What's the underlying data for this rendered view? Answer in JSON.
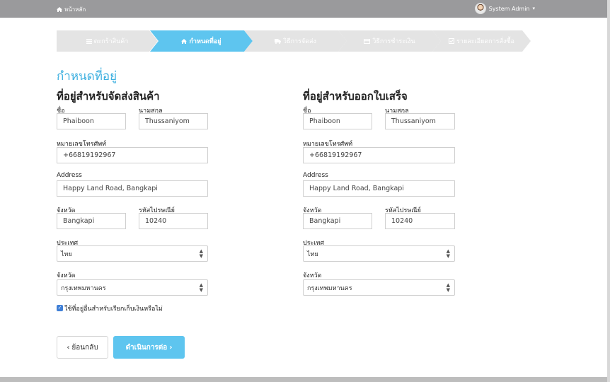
{
  "topbar": {
    "home_label": "หน้าหลัก",
    "user_name": "System Admin",
    "user_caret": "▾"
  },
  "steps": [
    {
      "label": "ตะกร้าสินค้า",
      "icon": "list-icon"
    },
    {
      "label": "กำหนดที่อยู่",
      "icon": "home-icon"
    },
    {
      "label": "วิธีการจัดส่ง",
      "icon": "truck-icon"
    },
    {
      "label": "วิธีการชำระเงิน",
      "icon": "credit-card-icon"
    },
    {
      "label": "รายละเอียดการสั่งซื้อ",
      "icon": "check-square-icon"
    }
  ],
  "page_title": "กำหนดที่อยู่",
  "shipping": {
    "title": "ที่อยู่สำหรับจัดส่งสินค้า",
    "first_name_label": "ชื่อ",
    "first_name": "Phaiboon",
    "last_name_label": "นามสกุล",
    "last_name": "Thussaniyom",
    "phone_label": "หมายเลขโทรศัพท์",
    "phone": "+66819192967",
    "address_label": "Address",
    "address": "Happy Land Road, Bangkapi",
    "district_label": "จังหวัด",
    "district": "Bangkapi",
    "postcode_label": "รหัสไปรษณีย์",
    "postcode": "10240",
    "country_label": "ประเทศ",
    "country": "ไทย",
    "province_label": "จังหวัด",
    "province": "กรุงเทพมหานคร"
  },
  "billing": {
    "title": "ที่อยู่สำหรับออกใบเสร็จ",
    "first_name_label": "ชื่อ",
    "first_name": "Phaiboon",
    "last_name_label": "นามสกุล",
    "last_name": "Thussaniyom",
    "phone_label": "หมายเลขโทรศัพท์",
    "phone": "+66819192967",
    "address_label": "Address",
    "address": "Happy Land Road, Bangkapi",
    "district_label": "จังหวัด",
    "district": "Bangkapi",
    "postcode_label": "รหัสไปรษณีย์",
    "postcode": "10240",
    "country_label": "ประเทศ",
    "country": "ไทย",
    "province_label": "จังหวัด",
    "province": "กรุงเทพมหานคร"
  },
  "checkbox": {
    "checked": true,
    "label": "ใช้ที่อยู่อื่นสำหรับเรียกเก็บเงินหรือไม่"
  },
  "buttons": {
    "back": "ย้อนกลับ",
    "back_icon": "‹",
    "next": "ดำเนินการต่อ",
    "next_icon": "›"
  },
  "colors": {
    "accent": "#3eb0e0",
    "step_active": "#5ec5ef",
    "step_inactive": "#e4e4e4",
    "topbar": "#9a9a9c",
    "checkbox": "#3f7fd6"
  }
}
